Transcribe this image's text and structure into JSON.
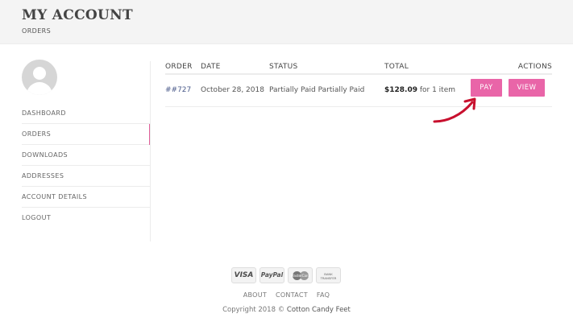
{
  "header": {
    "title": "MY ACCOUNT",
    "breadcrumb": "ORDERS"
  },
  "sidebar": {
    "items": [
      {
        "label": "DASHBOARD",
        "active": false
      },
      {
        "label": "ORDERS",
        "active": true
      },
      {
        "label": "DOWNLOADS",
        "active": false
      },
      {
        "label": "ADDRESSES",
        "active": false
      },
      {
        "label": "ACCOUNT DETAILS",
        "active": false
      },
      {
        "label": "LOGOUT",
        "active": false
      }
    ]
  },
  "orders_table": {
    "columns": [
      "ORDER",
      "DATE",
      "STATUS",
      "TOTAL",
      "ACTIONS"
    ],
    "rows": [
      {
        "order": "##727",
        "date": "October 28, 2018",
        "status": "Partially Paid Partially Paid",
        "total_amount": "$128.09",
        "total_suffix": " for 1 item",
        "actions": [
          "PAY",
          "VIEW"
        ]
      }
    ]
  },
  "footer": {
    "payment_icons": [
      "VISA",
      "PayPal",
      "MasterCard",
      "BANK TRANSFER"
    ],
    "links": [
      "ABOUT",
      "CONTACT",
      "FAQ"
    ],
    "copyright_prefix": "Copyright 2018 © ",
    "brand": "Cotton Candy Feet"
  },
  "colors": {
    "accent": "#e965a8",
    "header_bg": "#f4f4f4",
    "annotation_arrow": "#c8102e"
  }
}
